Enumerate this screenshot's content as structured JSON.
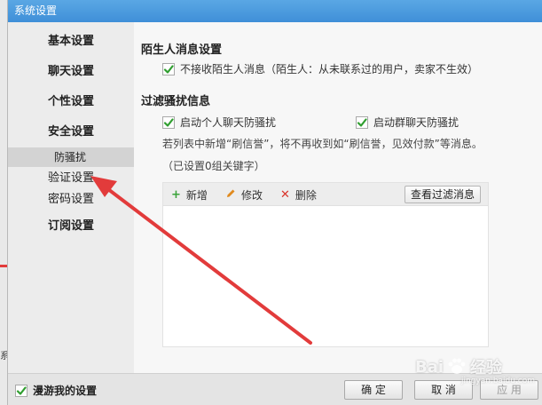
{
  "window": {
    "title": "系统设置"
  },
  "sidebar": {
    "items": [
      {
        "label": "基本设置"
      },
      {
        "label": "聊天设置"
      },
      {
        "label": "个性设置"
      },
      {
        "label": "安全设置"
      }
    ],
    "security_sub": [
      {
        "label": "防骚扰",
        "selected": true
      },
      {
        "label": "验证设置"
      },
      {
        "label": "密码设置"
      }
    ],
    "subscribe": {
      "label": "订阅设置"
    }
  },
  "stranger": {
    "title": "陌生人消息设置",
    "option": {
      "label": "不接收陌生人消息（陌生人：从未联系过的用户，卖家不生效）",
      "checked": true
    }
  },
  "filter": {
    "title": "过滤骚扰信息",
    "personal": {
      "label": "启动个人聊天防骚扰",
      "checked": true
    },
    "group": {
      "label": "启动群聊天防骚扰",
      "checked": true
    },
    "desc": "若列表中新增“刷信誉”，将不再收到如“刷信誉，见效付款”等消息。",
    "count": "（已设置0组关键字）",
    "toolbar": {
      "add": "新增",
      "edit": "修改",
      "delete": "删除",
      "view": "查看过滤消息"
    }
  },
  "footer": {
    "roam": {
      "label": "漫游我的设置",
      "checked": true
    },
    "ok": "确 定",
    "cancel": "取 消",
    "apply": "应 用"
  },
  "background": {
    "char": "系"
  },
  "watermark": {
    "text_left": "Bai",
    "text_right": "经验",
    "sub": "jingyan.baidu.com"
  },
  "colors": {
    "titlebar": "#4a9be0",
    "check": "#2f9e2f",
    "add_icon": "#3aa33a",
    "edit_icon": "#e08a1e",
    "delete_icon": "#d9342b",
    "annotation_arrow": "#e23b3b"
  }
}
